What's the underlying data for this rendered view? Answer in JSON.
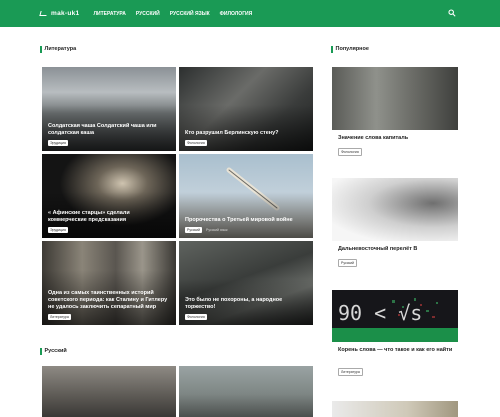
{
  "site": {
    "logo": "mak-uk1"
  },
  "nav": [
    "ЛИТЕРАТУРА",
    "РУССКИЙ",
    "РУССКИЙ ЯЗЫК",
    "ФИЛОЛОГИЯ"
  ],
  "literature": {
    "heading": "Литература",
    "tiles": [
      {
        "title": "Солдатская чаша Солдатский чаша или солдатская каша",
        "tag": "Эрудиция",
        "date": ""
      },
      {
        "title": "Кто разрушил Берлинскую стену?",
        "tag": "Филология",
        "date": ""
      },
      {
        "title": "« Афинские старцы» сделали коммерческие предсказания",
        "tag": "Эрудиция",
        "date": ""
      },
      {
        "title": "Пророчества о Третьей мировой войне",
        "tag": "Русский",
        "date": "Русский язык"
      },
      {
        "title": "Одна из самых таинственных историй советского периода: как Сталину и Гитлеру не удалось заключить сепаратный мир",
        "tag": "Литература",
        "date": ""
      },
      {
        "title": "Это было не похороны, а народное торжество!",
        "tag": "Филология",
        "date": ""
      }
    ]
  },
  "russian": {
    "heading": "Русский"
  },
  "popular": {
    "heading": "Популярное",
    "items": [
      {
        "title": "Значение слова капиталь",
        "tag": "Филология",
        "date": ""
      },
      {
        "title": "Дальневосточный перелёт В",
        "tag": "Русский",
        "date": ""
      },
      {
        "title": "Корень слова — что такое и как его найти",
        "tag": "Литература",
        "date": ""
      }
    ]
  },
  "colors": {
    "accent": "#1a9a55"
  }
}
